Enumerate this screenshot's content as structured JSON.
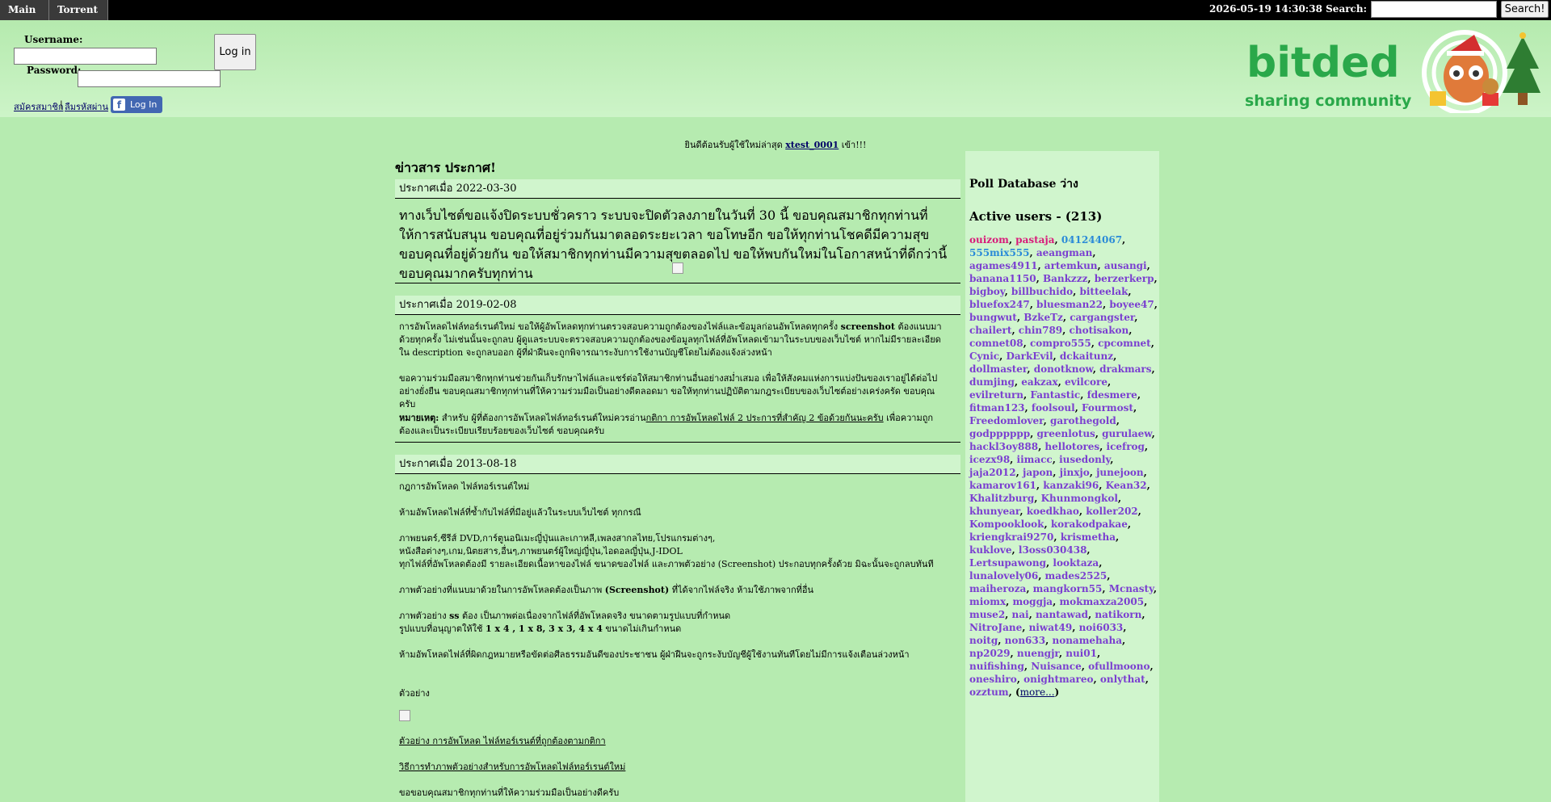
{
  "topbar": {
    "menus": [
      "Main",
      "Torrent"
    ],
    "datetime": "2026-05-19 14:30:38",
    "search_label": "Search:",
    "search_button": "Search!"
  },
  "login": {
    "username_label": "Username:",
    "password_label": "Password:",
    "login_button": "Log in",
    "link1": "สมัครสมาชิก",
    "link2": "ลืมรหัสผ่าน",
    "fb_label": "Log In"
  },
  "logo": {
    "name": "bitded",
    "tagline": "sharing community"
  },
  "welcome": {
    "prefix": "ยินดีต้อนรับผู้ใช้ใหม่ล่าสุด",
    "user": "xtest_0001",
    "suffix": "เข้า!!!"
  },
  "news": {
    "heading": "ข่าวสาร ประกาศ!",
    "items": [
      {
        "date": "ประกาศเมื่อ 2022-03-30",
        "body": "ทางเว็บไซต์ขอแจ้งปิดระบบชั่วคราว ระบบจะปิดตัวลงภายในวันที่ 30 นี้ ขอบคุณสมาชิกทุกท่านที่ให้การสนับสนุน ขอบคุณที่อยู่ร่วมกันมาตลอดระยะเวลา ขอโทษอีก ขอให้ทุกท่านโชคดีมีความสุข ขอบคุณที่อยู่ด้วยกัน ขอให้สมาชิกทุกท่านมีความสุขตลอดไป ขอให้พบกันใหม่ในโอกาสหน้าที่ดีกว่านี้ ขอบคุณมากครับทุกท่าน"
      },
      {
        "date": "ประกาศเมื่อ 2019-02-08",
        "p1a": "การอัพโหลดไฟล์ทอร์เรนต์ใหม่ ขอให้ผู้อัพโหลดทุกท่านตรวจสอบความถูกต้องของไฟล์และข้อมูลก่อนอัพโหลดทุกครั้ง",
        "p1b": "screenshot",
        "p1c": "ต้องแนบมาด้วยทุกครั้ง ไม่เช่นนั้นจะถูกลบ ผู้ดูแลระบบจะตรวจสอบความถูกต้องของข้อมูลทุกไฟล์ที่อัพโหลดเข้ามาในระบบของเว็บไซต์ หากไม่มีรายละเอียดใน description จะถูกลบออก ผู้ที่ฝ่าฝืนจะถูกพิจารณาระงับการใช้งานบัญชีโดยไม่ต้องแจ้งล่วงหน้า",
        "p2": "ขอความร่วมมือสมาชิกทุกท่านช่วยกันเก็บรักษาไฟล์และแชร์ต่อให้สมาชิกท่านอื่นอย่างสม่ำเสมอ เพื่อให้สังคมแห่งการแบ่งปันของเราอยู่ได้ต่อไปอย่างยั่งยืน ขอบคุณสมาชิกทุกท่านที่ให้ความร่วมมือเป็นอย่างดีตลอดมา ขอให้ทุกท่านปฏิบัติตามกฎระเบียบของเว็บไซต์อย่างเคร่งครัด ขอบคุณครับ",
        "p3a": "หมายเหตุ:",
        "p3b": "สำหรับ ผู้ที่ต้องการอัพโหลดไฟล์ทอร์เรนต์ใหม่ควรอ่าน",
        "p3c": "กติกา การอัพโหลดไฟล์ 2 ประการที่สำคัญ 2 ข้อด้วยกันนะครับ",
        "p3d": "เพื่อความถูกต้องและเป็นระเบียบเรียบร้อยของเว็บไซต์ ขอบคุณครับ"
      },
      {
        "date": "ประกาศเมื่อ 2013-08-18",
        "l1": "กฎการอัพโหลด ไฟล์ทอร์เรนต์ใหม่",
        "l2": "ห้ามอัพโหลดไฟล์ที่ซ้ำกับไฟล์ที่มีอยู่แล้วในระบบเว็บไซต์ ทุกกรณี",
        "l3": "ภาพยนตร์,ซีรีส์ DVD,การ์ตูนอนิเมะญี่ปุ่นและเกาหลี,เพลงสากลไทย,โปรแกรมต่างๆ,",
        "l4": "หนังสือต่างๆ,เกม,นิตยสาร,อื่นๆ,ภาพยนตร์ผู้ใหญ่ญี่ปุ่น,ไอดอลญี่ปุ่น,J-IDOL",
        "l5": "ทุกไฟล์ที่อัพโหลดต้องมี รายละเอียดเนื้อหาของไฟล์ ขนาดของไฟล์ และภาพตัวอย่าง (Screenshot) ประกอบทุกครั้งด้วย มิฉะนั้นจะถูกลบทันที",
        "l6a": "ภาพตัวอย่างที่แนบมาด้วยในการอัพโหลดต้องเป็นภาพ",
        "l6b": "(Screenshot)",
        "l6c": "ที่ได้จากไฟล์จริง ห้ามใช้ภาพจากที่อื่น",
        "l7a": "ภาพตัวอย่าง",
        "l7b": "ss",
        "l7c": "ต้อง เป็นภาพต่อเนื่องจากไฟล์ที่อัพโหลดจริง ขนาดตามรูปแบบที่กำหนด",
        "l8a": "รูปแบบที่อนุญาตให้ใช้",
        "l8b": "1 x 4 , 1 x 8, 3 x 3, 4 x 4",
        "l8c": "ขนาดไม่เกินกำหนด",
        "l9": "ห้ามอัพโหลดไฟล์ที่ผิดกฎหมายหรือขัดต่อศีลธรรมอันดีของประชาชน ผู้ฝ่าฝืนจะถูกระงับบัญชีผู้ใช้งานทันทีโดยไม่มีการแจ้งเตือนล่วงหน้า",
        "l10": "ตัวอย่าง",
        "link1": "ตัวอย่าง การอัพโหลด ไฟล์ทอร์เรนต์ที่ถูกต้องตามกติกา",
        "link2": "วิธีการทำภาพตัวอย่างสำหรับการอัพโหลดไฟล์ทอร์เรนต์ใหม่",
        "l11": "ขอขอบคุณสมาชิกทุกท่านที่ให้ความร่วมมือเป็นอย่างดีครับ"
      }
    ]
  },
  "sidebar": {
    "poll_title": "Poll Database ว่าง",
    "active_title": "Active users - (213)",
    "users": [
      "ouizom",
      "pastaja",
      "041244067",
      "555mix555",
      "aeangman",
      "agames4911",
      "artemkun",
      "ausangi",
      "banana1150",
      "Bankzzz",
      "berzerkerp",
      "bigboy",
      "billbuchido",
      "bitteelak",
      "bluefox247",
      "bluesman22",
      "boyee47",
      "bungwut",
      "BzkeTz",
      "cargangster",
      "chailert",
      "chin789",
      "chotisakon",
      "comnet08",
      "compro555",
      "cpcomnet",
      "Cynic",
      "DarkEvil",
      "dckaitunz",
      "dollmaster",
      "donotknow",
      "drakmars",
      "dumjing",
      "eakzax",
      "evilcore",
      "evilreturn",
      "Fantastic",
      "fdesmere",
      "fitman123",
      "foolsoul",
      "Fourmost",
      "Freedomlover",
      "garothegold",
      "godpppppp",
      "greenlotus",
      "gurulaew",
      "hackl3oy888",
      "hellotores",
      "icefrog",
      "icezx98",
      "iimacc",
      "iusedonly",
      "jaja2012",
      "japon",
      "jinxjo",
      "junejoon",
      "kamarov161",
      "kanzaki96",
      "Kean32",
      "Khalitzburg",
      "Khunmongkol",
      "khunyear",
      "koedkhao",
      "koller202",
      "Kompooklook",
      "korakodpakae",
      "kriengkrai9270",
      "krismetha",
      "kuklove",
      "l3oss030438",
      "Lertsupawong",
      "looktaza",
      "lunalovely06",
      "mades2525",
      "maiheroza",
      "mangkorn55",
      "Mcnasty",
      "miomx",
      "moggja",
      "mokmaxza2005",
      "muse2",
      "nai",
      "nantawad",
      "natikorn",
      "NitroJane",
      "niwat49",
      "noi6033",
      "noitg",
      "non633",
      "nonamehaha",
      "np2029",
      "nuengjr",
      "nui01",
      "nuifishing",
      "Nuisance",
      "ofullmoono",
      "oneshiro",
      "onightmareo",
      "onlythat",
      "ozztum"
    ],
    "more": "more..."
  },
  "colors": {
    "bg": "#b6ebb0",
    "panel": "#d0f5cd",
    "user": "#7a3fd0",
    "admin": "#d81b7a",
    "brand": "#2aa84a"
  }
}
